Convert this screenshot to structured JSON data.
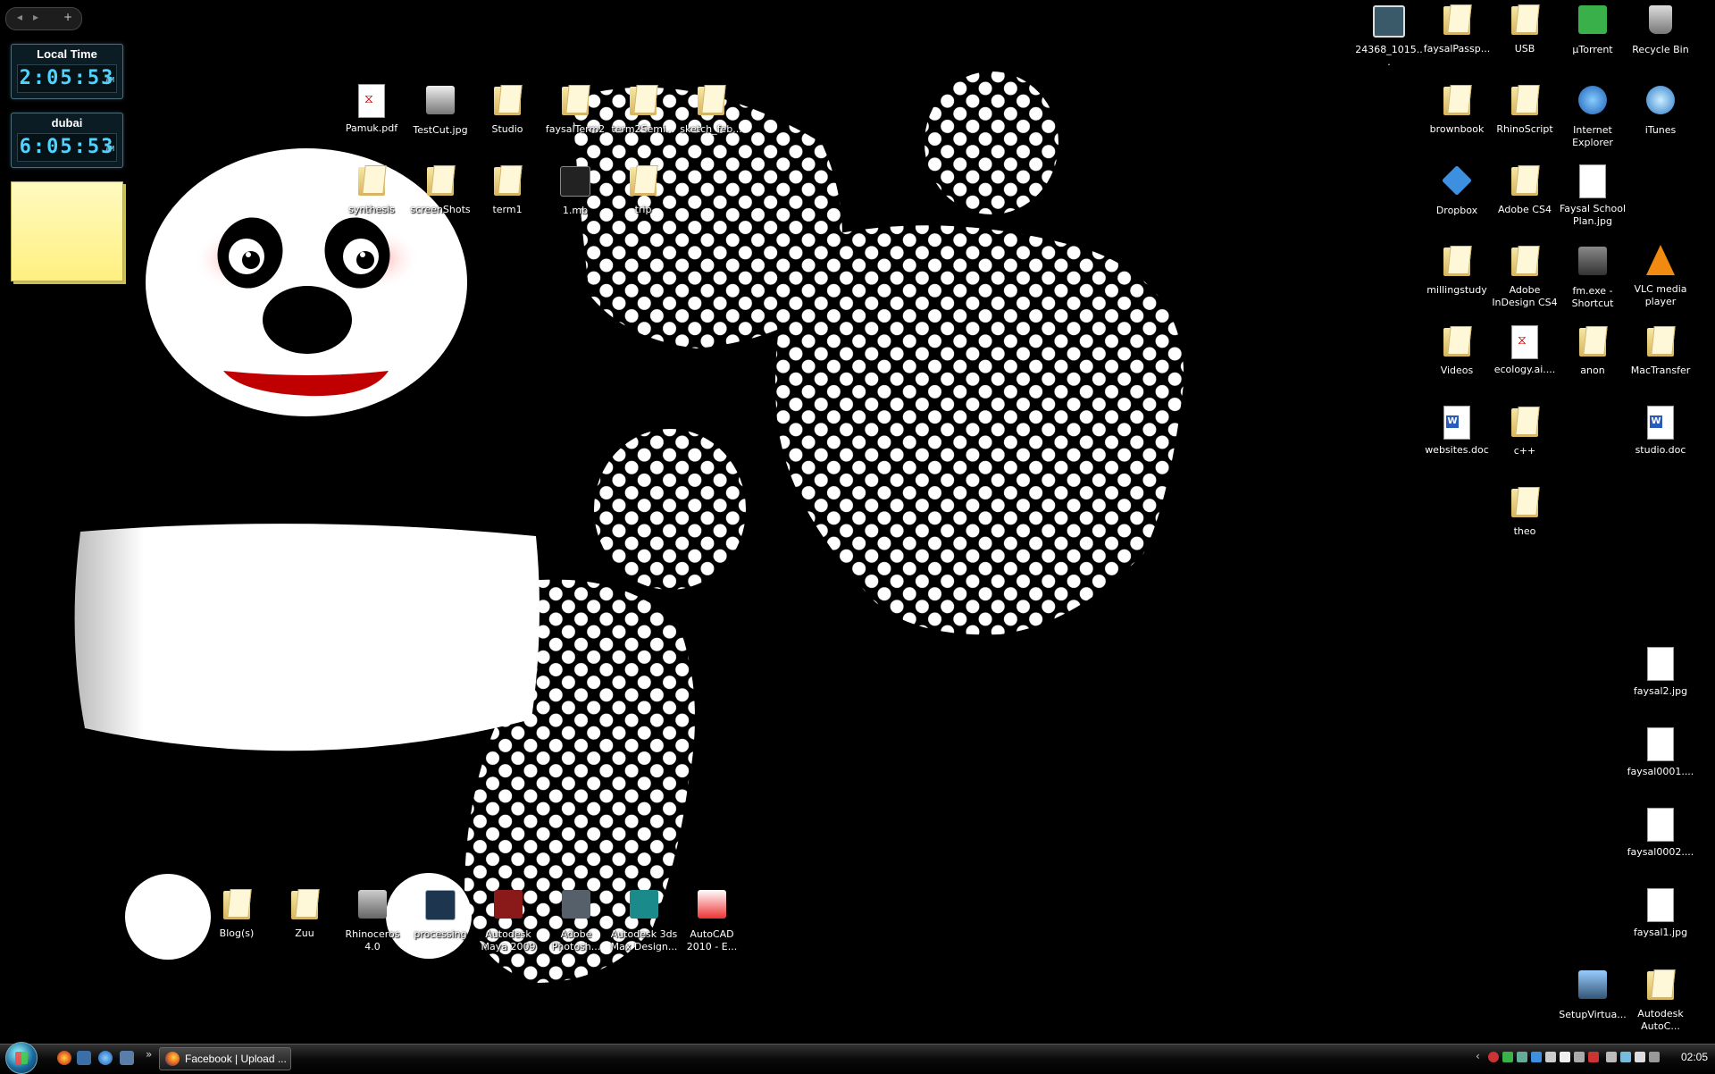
{
  "gadgets": {
    "clocks": [
      {
        "city": "Local Time",
        "time": "2:05:53",
        "ampm": "AM"
      },
      {
        "city": "dubai",
        "time": "6:05:53",
        "ampm": "AM"
      }
    ],
    "bar_plus": "+"
  },
  "desktop_icons": {
    "row1": [
      {
        "label": "Pamuk.pdf",
        "icon": "pdf-file-icon"
      },
      {
        "label": "TestCut.jpg",
        "icon": "image-file-icon"
      },
      {
        "label": "Studio",
        "icon": "folder-icon"
      },
      {
        "label": "faysalTerm2",
        "icon": "folder-icon"
      },
      {
        "label": "term2Semi...",
        "icon": "folder-icon"
      },
      {
        "label": "sketch_feb...",
        "icon": "folder-icon"
      }
    ],
    "row2": [
      {
        "label": "synthesis",
        "icon": "folder-icon"
      },
      {
        "label": "screenShots",
        "icon": "folder-icon"
      },
      {
        "label": "term1",
        "icon": "folder-icon"
      },
      {
        "label": "1.mb",
        "icon": "maya-file-icon"
      },
      {
        "label": "trip",
        "icon": "folder-icon"
      }
    ],
    "bottom": [
      {
        "label": "Blog(s)",
        "icon": "folder-icon"
      },
      {
        "label": "Zuu",
        "icon": "folder-icon"
      },
      {
        "label": "Rhinoceros 4.0",
        "icon": "rhino-icon"
      },
      {
        "label": "processing",
        "icon": "processing-icon"
      },
      {
        "label": "Autodesk Maya 2009",
        "icon": "maya-icon"
      },
      {
        "label": "Adobe Photosh...",
        "icon": "photoshop-icon"
      },
      {
        "label": "Autodesk 3ds Max Design...",
        "icon": "3dsmax-icon"
      },
      {
        "label": "AutoCAD 2010 - E...",
        "icon": "autocad-icon"
      }
    ],
    "right": [
      {
        "label": "24368_1015...",
        "icon": "image-file-icon"
      },
      {
        "label": "faysalPassp...",
        "icon": "folder-icon"
      },
      {
        "label": "USB",
        "icon": "folder-icon"
      },
      {
        "label": "µTorrent",
        "icon": "utorrent-icon"
      },
      {
        "label": "Recycle Bin",
        "icon": "recycle-bin-icon"
      },
      {
        "label": "brownbook",
        "icon": "folder-icon"
      },
      {
        "label": "RhinoScript",
        "icon": "folder-icon"
      },
      {
        "label": "Internet Explorer",
        "icon": "internet-explorer-icon"
      },
      {
        "label": "iTunes",
        "icon": "itunes-icon"
      },
      {
        "label": "Dropbox",
        "icon": "dropbox-icon"
      },
      {
        "label": "Adobe CS4",
        "icon": "folder-icon"
      },
      {
        "label": "Faysal School Plan.jpg",
        "icon": "image-file-icon"
      },
      {
        "label": "millingstudy",
        "icon": "folder-icon"
      },
      {
        "label": "Adobe InDesign CS4",
        "icon": "folder-icon"
      },
      {
        "label": "fm.exe - Shortcut",
        "icon": "shortcut-icon"
      },
      {
        "label": "VLC media player",
        "icon": "vlc-icon"
      },
      {
        "label": "Videos",
        "icon": "folder-icon"
      },
      {
        "label": "ecology.ai....",
        "icon": "pdf-file-icon"
      },
      {
        "label": "anon",
        "icon": "folder-icon"
      },
      {
        "label": "MacTransfer",
        "icon": "folder-icon"
      },
      {
        "label": "websites.doc",
        "icon": "word-doc-icon"
      },
      {
        "label": "c++",
        "icon": "folder-icon"
      },
      {
        "label": "studio.doc",
        "icon": "word-doc-icon"
      },
      {
        "label": "theo",
        "icon": "folder-icon"
      },
      {
        "label": "faysal2.jpg",
        "icon": "image-file-icon"
      },
      {
        "label": "faysal0001....",
        "icon": "image-file-icon"
      },
      {
        "label": "faysal0002....",
        "icon": "image-file-icon"
      },
      {
        "label": "faysal1.jpg",
        "icon": "image-file-icon"
      },
      {
        "label": "SetupVirtua...",
        "icon": "installer-icon"
      },
      {
        "label": "Autodesk AutoC...",
        "icon": "folder-icon"
      }
    ]
  },
  "taskbar": {
    "task_label": "Facebook | Upload ...",
    "clock": "02:05",
    "chevron": "»",
    "tray_arrow": "‹"
  },
  "colors": {
    "background": "#000000",
    "clock_digits": "#4fd3ff",
    "sticky": "#fff49a",
    "panda_mouth": "#c00000"
  }
}
